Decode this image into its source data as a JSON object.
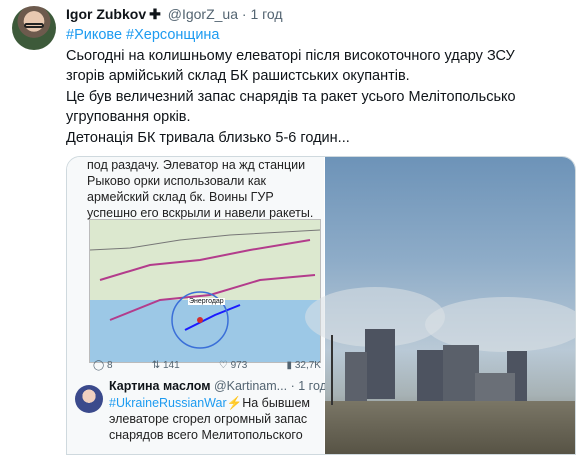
{
  "author": {
    "name": "Igor Zubkov",
    "plus": "✚",
    "handle": "@IgorZ_ua",
    "separator": "·",
    "time": "1 год"
  },
  "tweet": {
    "hashtags": "#Рикове #Херсонщина",
    "lines": [
      "Сьогодні на колишньому елеваторі після високоточного удару ЗСУ",
      "згорів армійський склад БК рашистських окупантів.",
      "Це був величезний запас снарядів та ракет усього Мелітопольсько",
      "угруповання орків.",
      "Детонація БК тривала близько 5-6 годин..."
    ]
  },
  "media_left": {
    "ru_text": "под раздачу. Элеватор на жд станции Рыково орки использовали как армейский склад бк. Воины ГУР успешно его вскрыли и навели ракеты.",
    "map_label": "Энергодар",
    "stats": {
      "replies": "8",
      "retweets": "141",
      "likes": "973",
      "views": "32,7K"
    },
    "quote": {
      "name": "Картина маслом",
      "handle": "@Kartinam...",
      "separator": "·",
      "time": "1 год",
      "hashtag": "#UkraineRussianWar",
      "text_rest": "На бывшем элеваторе сгорел огромный запас снарядов всего Мелитопольского",
      "bolt": "⚡"
    }
  },
  "icons": {
    "reply": "reply-icon",
    "retweet": "retweet-icon",
    "like": "like-icon",
    "views": "views-icon"
  },
  "colors": {
    "link": "#1d9bf0",
    "muted": "#536471",
    "border": "#cfd9de"
  }
}
